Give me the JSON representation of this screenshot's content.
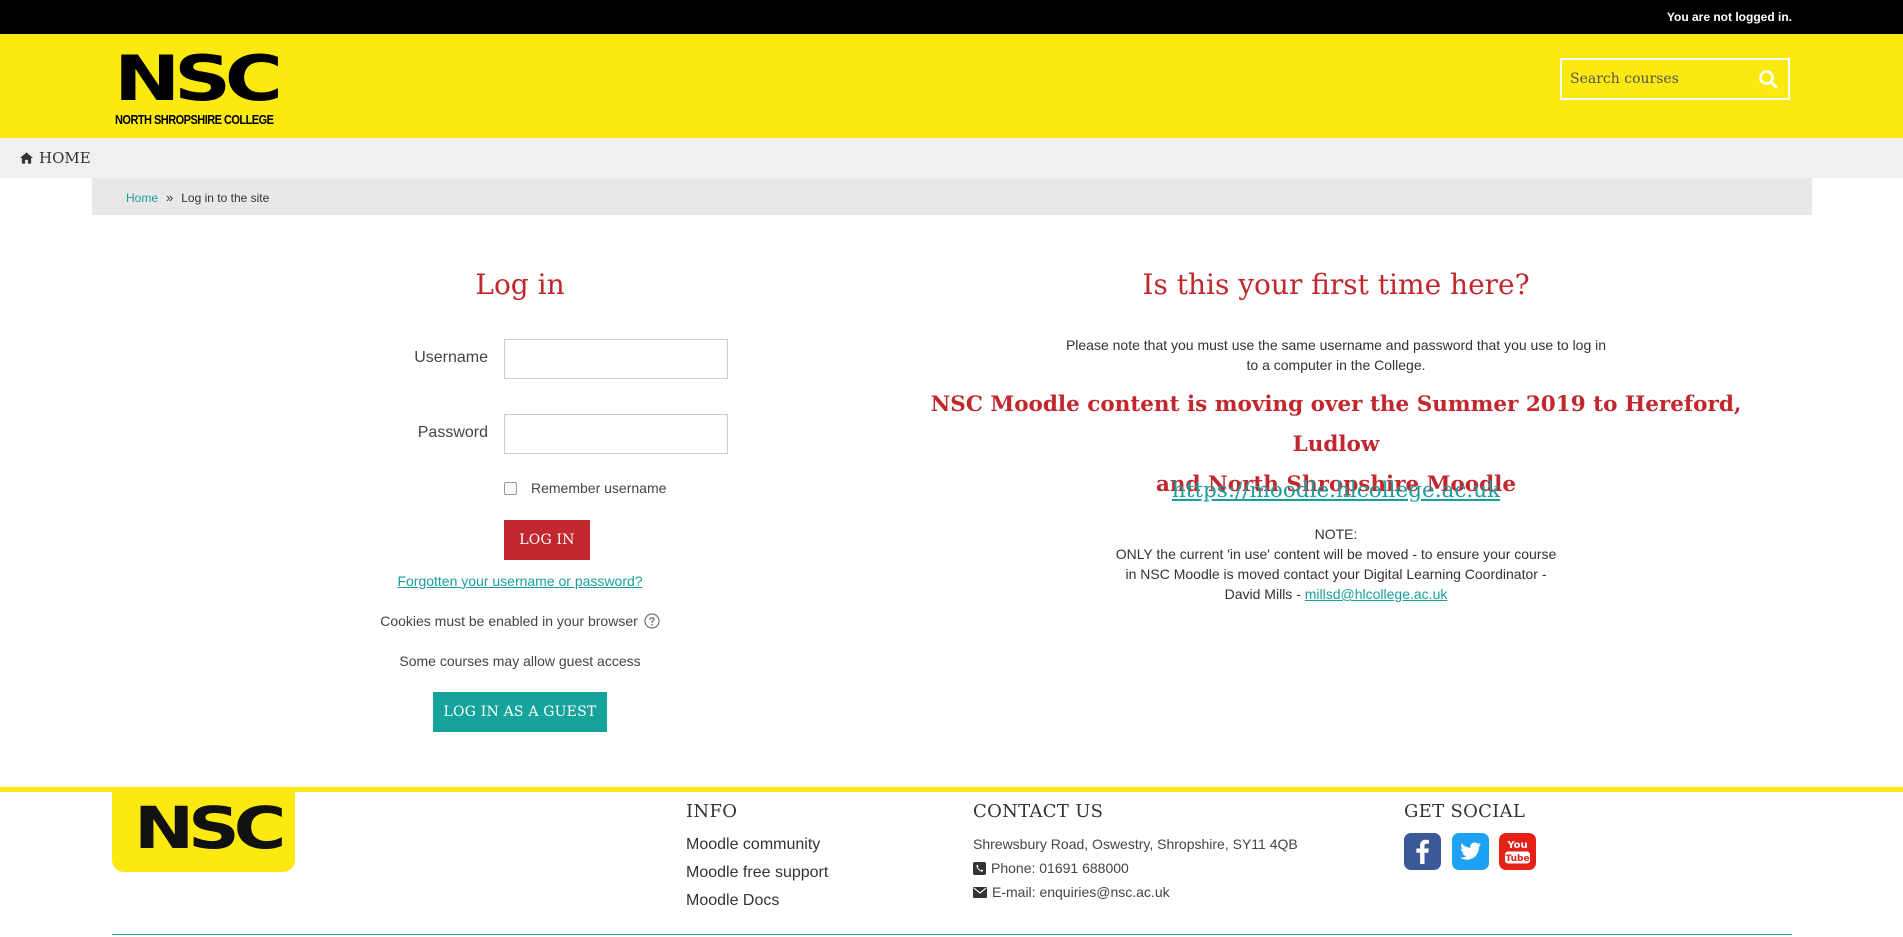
{
  "topbar": {
    "login_status": "You are not logged in."
  },
  "header": {
    "logo_word": "NSC",
    "logo_sub": "NORTH SHROPSHIRE COLLEGE",
    "search_placeholder": "Search courses"
  },
  "nav": {
    "home_label": "HOME"
  },
  "breadcrumb": {
    "home": "Home",
    "separator": "»",
    "current": "Log in to the site"
  },
  "login": {
    "title": "Log in",
    "username_label": "Username",
    "username_value": "",
    "password_label": "Password",
    "password_value": "",
    "remember_label": "Remember username",
    "login_button": "LOG IN",
    "forgot_link": "Forgotten your username or password?",
    "cookies_note": "Cookies must be enabled in your browser",
    "guest_note": "Some courses may allow guest access",
    "guest_button": "LOG IN AS A GUEST"
  },
  "info": {
    "title": "Is this your first time here?",
    "para_line1": "Please note that you must use the same username and password that you use to log in",
    "para_line2": "to a computer in the College.",
    "moving_line1": "NSC Moodle content is moving over the Summer 2019 to Hereford, Ludlow",
    "moving_line2": "and North Shropshire Moodle",
    "link": "https://moodle.hlcollege.ac.uk",
    "note_label": "NOTE:",
    "note_line1": "ONLY the current 'in use' content will be moved - to ensure your course",
    "note_line2": "in NSC Moodle is moved contact your Digital Learning Coordinator -",
    "note_line3_prefix": "David Mills - ",
    "note_email": "millsd@hlcollege.ac.uk"
  },
  "footer": {
    "logo_word": "NSC",
    "info_heading": "INFO",
    "info_links": [
      "Moodle community",
      "Moodle free support",
      "Moodle Docs"
    ],
    "contact_heading": "CONTACT US",
    "address": "Shrewsbury Road, Oswestry, Shropshire, SY11 4QB",
    "phone": "Phone: 01691 688000",
    "email": "E-mail: enquiries@nsc.ac.uk",
    "social_heading": "GET SOCIAL"
  },
  "colors": {
    "brand_yellow": "#fbe90f",
    "accent_red": "#c1272d",
    "accent_teal": "#16a39b",
    "facebook": "#3b5998",
    "twitter": "#1da1f2",
    "youtube": "#e62117"
  },
  "icons": [
    "home-icon",
    "search-icon",
    "question-circle-icon",
    "phone-icon",
    "envelope-icon",
    "facebook-icon",
    "twitter-icon",
    "youtube-icon"
  ]
}
